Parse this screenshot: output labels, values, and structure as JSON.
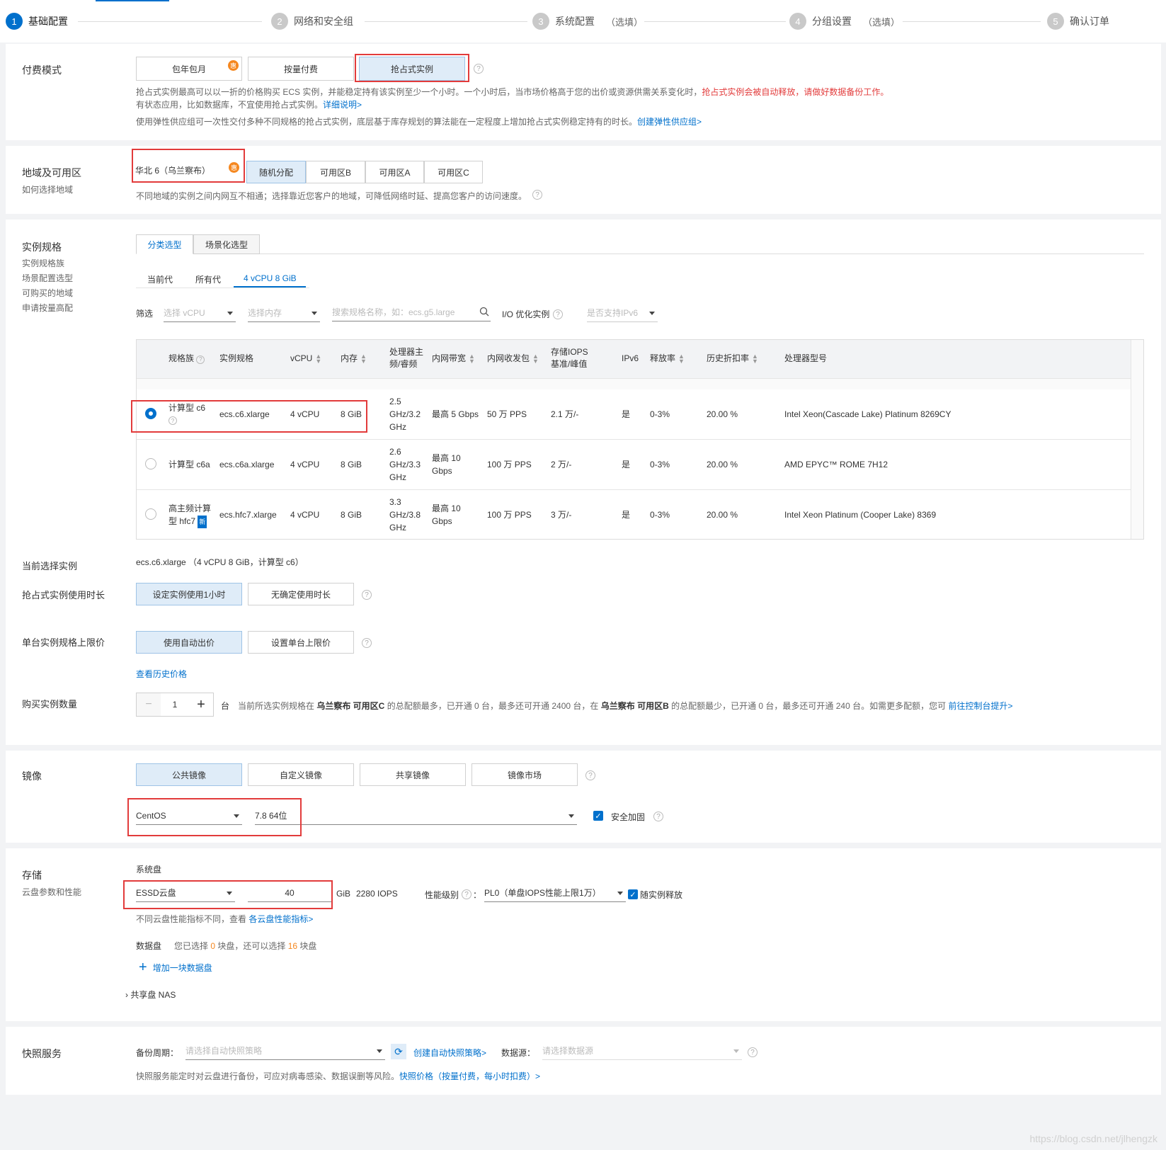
{
  "steps": [
    {
      "num": "1",
      "label": "基础配置",
      "opt": ""
    },
    {
      "num": "2",
      "label": "网络和安全组",
      "opt": ""
    },
    {
      "num": "3",
      "label": "系统配置",
      "opt": "（选填）"
    },
    {
      "num": "4",
      "label": "分组设置",
      "opt": "（选填）"
    },
    {
      "num": "5",
      "label": "确认订单",
      "opt": ""
    }
  ],
  "billing": {
    "label": "付费模式",
    "options": [
      "包年包月",
      "按量付费",
      "抢占式实例"
    ],
    "hot": "惠",
    "help": "?",
    "note1a": "抢占式实例最高可以以一折的价格购买 ECS 实例，并能稳定持有该实例至少一个小时。一个小时后，当市场价格高于您的出价或资源供需关系变化时，",
    "note1b": "抢占式实例会被自动释放，请做好数据备份工作。",
    "note2a": "有状态应用，比如数据库，不宜使用抢占式实例。",
    "note2b": "详细说明>",
    "note3a": "使用弹性供应组可一次性交付多种不同规格的抢占式实例，底层基于库存规划的算法能在一定程度上增加抢占式实例稳定持有的时长。",
    "note3b": "创建弹性供应组>"
  },
  "region": {
    "label": "地域及可用区",
    "sub": "如何选择地域",
    "region_value": "华北 6（乌兰察布）",
    "hot": "惠",
    "zones": [
      "随机分配",
      "可用区B",
      "可用区A",
      "可用区C"
    ],
    "note": "不同地域的实例之间内网互不相通；选择靠近您客户的地域，可降低网络时延、提高您客户的访问速度。"
  },
  "spec": {
    "label": "实例规格",
    "subs": [
      "实例规格族",
      "场景配置选型",
      "可购买的地域",
      "申请按量高配"
    ],
    "tabs": [
      "分类选型",
      "场景化选型"
    ],
    "subtabs": [
      "当前代",
      "所有代",
      "4 vCPU 8 GiB"
    ],
    "filter_label": "筛选",
    "vcpu_ph": "选择 vCPU",
    "mem_ph": "选择内存",
    "search_ph": "搜索规格名称，如：ecs.g5.large",
    "io_label": "I/O 优化实例",
    "ipv6_ph": "是否支持IPv6",
    "columns": {
      "family": "规格族",
      "spec": "实例规格",
      "vcpu": "vCPU",
      "mem": "内存",
      "cpu_freq_1": "处理器主",
      "cpu_freq_2": "频/睿频",
      "bw": "内网带宽",
      "pps": "内网收发包",
      "iops_1": "存储IOPS",
      "iops_2": "基准/峰值",
      "ipv6": "IPv6",
      "release": "释放率",
      "discount": "历史折扣率",
      "cpu_model": "处理器型号"
    },
    "rows": [
      {
        "family": "计算型 c6",
        "spec": "ecs.c6.xlarge",
        "vcpu": "4 vCPU",
        "mem": "8 GiB",
        "freq": [
          "2.5",
          "GHz/3.2",
          "GHz"
        ],
        "bw": [
          "最高 5 Gbps"
        ],
        "pps": "50 万 PPS",
        "iops": "2.1 万/-",
        "ipv6": "是",
        "release": "0-3%",
        "discount": "20.00 %",
        "cpu": "Intel Xeon(Cascade Lake) Platinum 8269CY"
      },
      {
        "family": "计算型 c6a",
        "spec": "ecs.c6a.xlarge",
        "vcpu": "4 vCPU",
        "mem": "8 GiB",
        "freq": [
          "2.6",
          "GHz/3.3",
          "GHz"
        ],
        "bw": [
          "最高 10",
          "Gbps"
        ],
        "pps": "100 万 PPS",
        "iops": "2 万/-",
        "ipv6": "是",
        "release": "0-3%",
        "discount": "20.00 %",
        "cpu": "AMD EPYC™ ROME 7H12"
      },
      {
        "family": "高主频计算型 hfc7",
        "spec": "ecs.hfc7.xlarge",
        "vcpu": "4 vCPU",
        "mem": "8 GiB",
        "freq": [
          "3.3",
          "GHz/3.8",
          "GHz"
        ],
        "bw": [
          "最高 10",
          "Gbps"
        ],
        "pps": "100 万 PPS",
        "iops": "3 万/-",
        "ipv6": "是",
        "release": "0-3%",
        "discount": "20.00 %",
        "cpu": "Intel Xeon Platinum (Cooper Lake) 8369"
      }
    ],
    "family_line1_r3": "高主频计算",
    "family_line2_r3": "型 hfc7",
    "new_badge": "新"
  },
  "current": {
    "label": "当前选择实例",
    "value": "ecs.c6.xlarge （4 vCPU 8 GiB，计算型 c6）"
  },
  "duration": {
    "label": "抢占式实例使用时长",
    "options": [
      "设定实例使用1小时",
      "无确定使用时长"
    ]
  },
  "price": {
    "label": "单台实例规格上限价",
    "options": [
      "使用自动出价",
      "设置单台上限价"
    ],
    "history": "查看历史价格"
  },
  "quantity": {
    "label": "购买实例数量",
    "minus": "−",
    "value": "1",
    "plus": "+",
    "unit": "台",
    "note_parts": [
      "当前所选实例规格在 ",
      "乌兰察布 可用区C",
      " 的总配额最多，已开通 0 台，最多还可开通 2400 台，在 ",
      "乌兰察布 可用区B",
      " 的总配额最少，已开通 0 台，最多还可开通 240 台。如需更多配额，您可 "
    ],
    "link": "前往控制台提升>"
  },
  "image": {
    "label": "镜像",
    "options": [
      "公共镜像",
      "自定义镜像",
      "共享镜像",
      "镜像市场"
    ],
    "os": "CentOS",
    "version": "7.8 64位",
    "harden": "安全加固"
  },
  "storage": {
    "label": "存储",
    "sub": "云盘参数和性能",
    "system_disk": "系统盘",
    "disk_type": "ESSD云盘",
    "size": "40",
    "unit": "GiB",
    "iops": "2280 IOPS",
    "perf_label": "性能级别",
    "perf_value": "PL0（单盘IOPS性能上限1万）",
    "release": "随实例释放",
    "note_a": "不同云盘性能指标不同，查看 ",
    "note_b": "各云盘性能指标>",
    "data_label": "数据盘",
    "data_note_a": "您已选择 ",
    "data_sel": "0",
    "data_note_b": " 块盘，还可以选择 ",
    "data_max": "16",
    "data_note_c": " 块盘",
    "add": "增加一块数据盘",
    "nas": "共享盘 NAS"
  },
  "snapshot": {
    "label": "快照服务",
    "period_label": "备份周期：",
    "period_ph": "请选择自动快照策略",
    "create": "创建自动快照策略>",
    "source_label": "数据源：",
    "source_ph": "请选择数据源",
    "note_a": "快照服务能定时对云盘进行备份，可应对病毒感染、数据误删等风险。",
    "note_b": "快照价格（按量付费，每小时扣费）>"
  },
  "watermark": "https://blog.csdn.net/jlhengzk"
}
